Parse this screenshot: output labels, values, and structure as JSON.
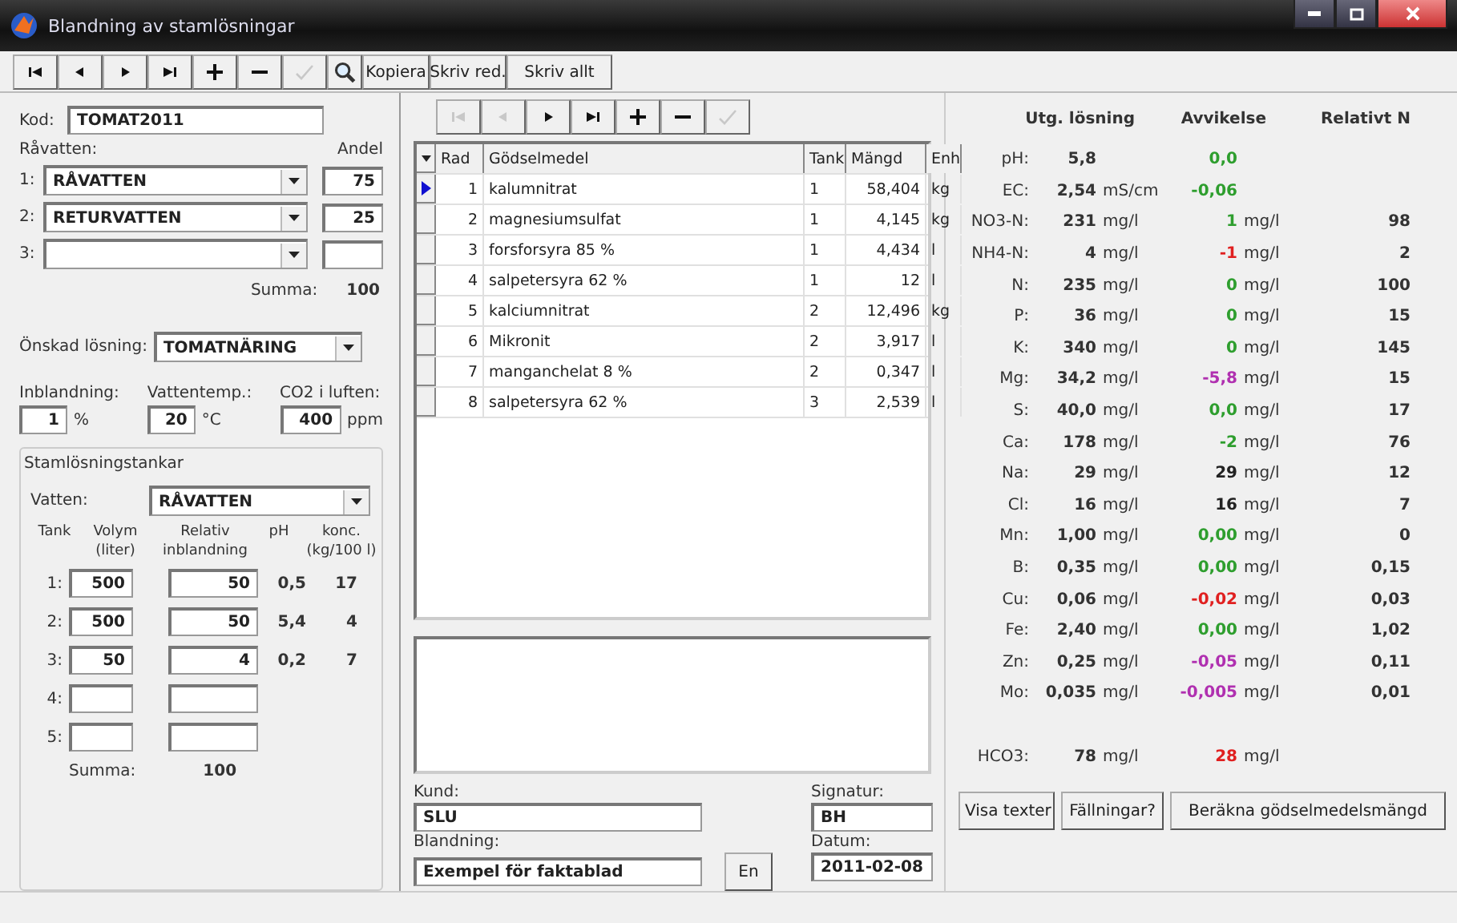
{
  "window": {
    "title": "Blandning av stamlösningar"
  },
  "toolbar": [
    {
      "kind": "first",
      "disabled": false
    },
    {
      "kind": "prev",
      "disabled": false
    },
    {
      "kind": "next",
      "disabled": false
    },
    {
      "kind": "last",
      "disabled": false
    },
    {
      "kind": "add",
      "disabled": false
    },
    {
      "kind": "remove",
      "disabled": false
    },
    {
      "kind": "save",
      "disabled": true
    },
    {
      "kind": "search",
      "disabled": false
    },
    {
      "kind": "text",
      "label": "Kopiera",
      "disabled": false
    },
    {
      "kind": "text",
      "label": "Skriv red.",
      "disabled": false
    },
    {
      "kind": "wide",
      "label": "Skriv allt",
      "disabled": false
    }
  ],
  "kod": {
    "label": "Kod:",
    "value": "TOMAT2011"
  },
  "ravatten": {
    "label": "Råvatten:",
    "share_label": "Andel",
    "rows": [
      {
        "num": "1:",
        "value": "RÅVATTEN",
        "share": "75"
      },
      {
        "num": "2:",
        "value": "RETURVATTEN",
        "share": "25"
      },
      {
        "num": "3:"
      }
    ],
    "sum_label": "Summa:",
    "sum": "100"
  },
  "onskad": {
    "label": "Önskad lösning:",
    "value": "TOMATNÄRING"
  },
  "params": [
    {
      "label": "Inblandning:",
      "value": "1",
      "unit": "%"
    },
    {
      "label": "Vattentemp.:",
      "value": "20",
      "unit": "°C"
    },
    {
      "label": "CO2 i luften:",
      "value": "400",
      "unit": "ppm"
    }
  ],
  "tanks": {
    "title": "Stamlösningstankar",
    "water_label": "Vatten:",
    "water": "RÅVATTEN",
    "headers": [
      "Tank",
      "Volym (liter)",
      "Relativ inblandning",
      "pH",
      "konc. (kg/100 l)"
    ],
    "rows": [
      {
        "num": "1:",
        "volym": "500",
        "relativ": "50",
        "ph": "0,5",
        "konc": "17"
      },
      {
        "num": "2:",
        "volym": "500",
        "relativ": "50",
        "ph": "5,4",
        "konc": "4"
      },
      {
        "num": "3:",
        "volym": "50",
        "relativ": "4",
        "ph": "0,2",
        "konc": "7"
      },
      {
        "num": "4:"
      },
      {
        "num": "5:"
      }
    ],
    "sum_label": "Summa:",
    "sum": "100"
  },
  "grid_nav": [
    {
      "kind": "first",
      "disabled": true
    },
    {
      "kind": "prev",
      "disabled": true
    },
    {
      "kind": "next",
      "disabled": false
    },
    {
      "kind": "last",
      "disabled": false
    },
    {
      "kind": "add",
      "disabled": false
    },
    {
      "kind": "remove",
      "disabled": false
    },
    {
      "kind": "save",
      "disabled": true
    }
  ],
  "table": {
    "columns": [
      "Rad",
      "Gödselmedel",
      "Tank",
      "Mängd",
      "Enh"
    ],
    "rows": [
      {
        "selected": true,
        "cells": [
          "1",
          "kalumnitrat",
          "1",
          "58,404",
          "kg"
        ]
      },
      {
        "selected": false,
        "cells": [
          "2",
          "magnesiumsulfat",
          "1",
          "4,145",
          "kg"
        ]
      },
      {
        "selected": false,
        "cells": [
          "3",
          "forsforsyra 85 %",
          "1",
          "4,434",
          "l"
        ]
      },
      {
        "selected": false,
        "cells": [
          "4",
          "salpetersyra 62 %",
          "1",
          "12",
          "l"
        ]
      },
      {
        "selected": false,
        "cells": [
          "5",
          "kalciumnitrat",
          "2",
          "12,496",
          "kg"
        ]
      },
      {
        "selected": false,
        "cells": [
          "6",
          "Mikronit",
          "2",
          "3,917",
          "l"
        ]
      },
      {
        "selected": false,
        "cells": [
          "7",
          "manganchelat 8 %",
          "2",
          "0,347",
          "l"
        ]
      },
      {
        "selected": false,
        "cells": [
          "8",
          "salpetersyra 62 %",
          "3",
          "2,539",
          "l"
        ]
      }
    ]
  },
  "customer": {
    "kund_label": "Kund:",
    "kund": "SLU",
    "signatur_label": "Signatur:",
    "signatur": "BH",
    "blandning_label": "Blandning:",
    "blandning": "Exempel för faktablad",
    "en_button": "En",
    "datum_label": "Datum:",
    "datum": "2011-02-08"
  },
  "results": {
    "headers": [
      "Utg. lösning",
      "Avvikelse",
      "Relativt N"
    ],
    "rows": [
      {
        "label": "pH:",
        "value": "5,8",
        "dev": "0,0",
        "color": "#2e9e2e"
      },
      {
        "label": "EC:",
        "value": "2,54",
        "unit": "mS/cm",
        "dev": "-0,06",
        "color": "#2e9e2e"
      },
      {
        "label": "NO3-N:",
        "value": "231",
        "unit": "mg/l",
        "dev": "1",
        "color": "#2e9e2e",
        "unit2": "mg/l",
        "rel": "98"
      },
      {
        "label": "NH4-N:",
        "value": "4",
        "unit": "mg/l",
        "dev": "-1",
        "color": "#e02020",
        "unit2": "mg/l",
        "rel": "2"
      },
      {
        "label": "N:",
        "value": "235",
        "unit": "mg/l",
        "dev": "0",
        "color": "#2e9e2e",
        "unit2": "mg/l",
        "rel": "100"
      },
      {
        "label": "P:",
        "value": "36",
        "unit": "mg/l",
        "dev": "0",
        "color": "#2e9e2e",
        "unit2": "mg/l",
        "rel": "15"
      },
      {
        "label": "K:",
        "value": "340",
        "unit": "mg/l",
        "dev": "0",
        "color": "#2e9e2e",
        "unit2": "mg/l",
        "rel": "145"
      },
      {
        "label": "Mg:",
        "value": "34,2",
        "unit": "mg/l",
        "dev": "-5,8",
        "color": "#b030b0",
        "unit2": "mg/l",
        "rel": "15"
      },
      {
        "label": "S:",
        "value": "40,0",
        "unit": "mg/l",
        "dev": "0,0",
        "color": "#2e9e2e",
        "unit2": "mg/l",
        "rel": "17"
      },
      {
        "label": "Ca:",
        "value": "178",
        "unit": "mg/l",
        "dev": "-2",
        "color": "#2e9e2e",
        "unit2": "mg/l",
        "rel": "76"
      },
      {
        "label": "Na:",
        "value": "29",
        "unit": "mg/l",
        "dev": "29",
        "color": "#222222",
        "unit2": "mg/l",
        "rel": "12"
      },
      {
        "label": "Cl:",
        "value": "16",
        "unit": "mg/l",
        "dev": "16",
        "color": "#222222",
        "unit2": "mg/l",
        "rel": "7"
      },
      {
        "label": "Mn:",
        "value": "1,00",
        "unit": "mg/l",
        "dev": "0,00",
        "color": "#2e9e2e",
        "unit2": "mg/l",
        "rel": "0"
      },
      {
        "label": "B:",
        "value": "0,35",
        "unit": "mg/l",
        "dev": "0,00",
        "color": "#2e9e2e",
        "unit2": "mg/l",
        "rel": "0,15"
      },
      {
        "label": "Cu:",
        "value": "0,06",
        "unit": "mg/l",
        "dev": "-0,02",
        "color": "#e02020",
        "unit2": "mg/l",
        "rel": "0,03"
      },
      {
        "label": "Fe:",
        "value": "2,40",
        "unit": "mg/l",
        "dev": "0,00",
        "color": "#2e9e2e",
        "unit2": "mg/l",
        "rel": "1,02"
      },
      {
        "label": "Zn:",
        "value": "0,25",
        "unit": "mg/l",
        "dev": "-0,05",
        "color": "#b030b0",
        "unit2": "mg/l",
        "rel": "0,11"
      },
      {
        "label": "Mo:",
        "value": "0,035",
        "unit": "mg/l",
        "dev": "-0,005",
        "color": "#b030b0",
        "unit2": "mg/l",
        "rel": "0,01"
      }
    ],
    "hco3": {
      "label": "HCO3:",
      "value": "78",
      "unit": "mg/l",
      "dev": "28",
      "color": "#e02020",
      "unit2": "mg/l"
    }
  },
  "buttons": [
    "Visa texter",
    "Fällningar?",
    "Beräkna gödselmedelsmängd"
  ]
}
